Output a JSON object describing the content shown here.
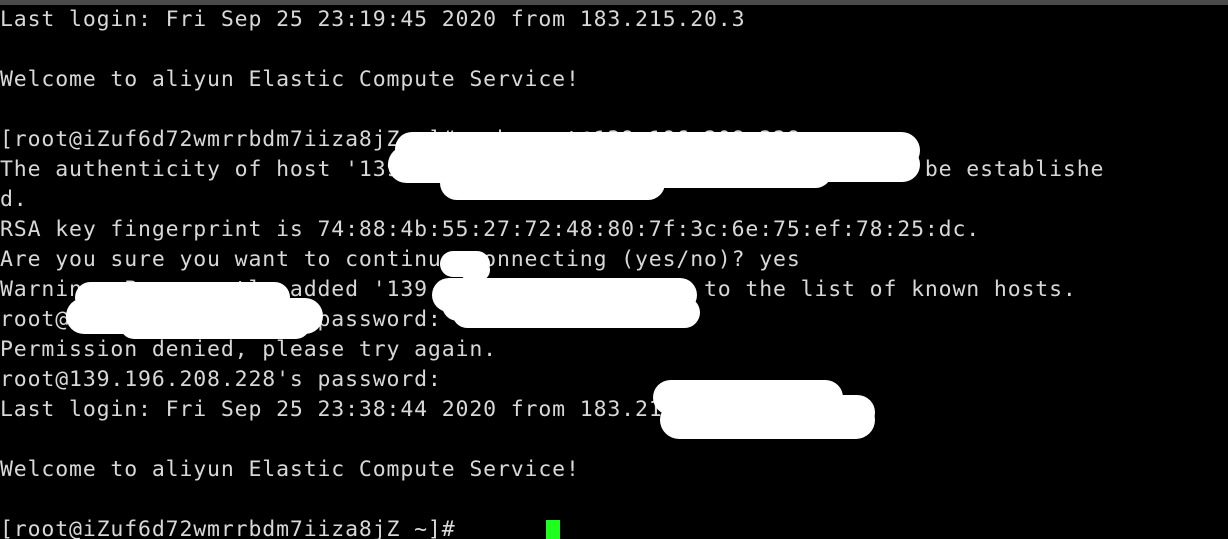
{
  "window": {
    "title_bar_color": "#4a4a4a",
    "background_color": "#000000",
    "foreground_color": "#d8d8d8",
    "cursor_color": "#1eff1e",
    "redaction_color": "#ffffff"
  },
  "terminal": {
    "lines": [
      {
        "id": "line-last-login-1",
        "text": "Last login: Fri Sep 25 23:19:45 2020 from 183.215.20.3"
      },
      {
        "id": "line-blank-1",
        "text": ""
      },
      {
        "id": "line-welcome-1",
        "text": "Welcome to aliyun Elastic Compute Service!"
      },
      {
        "id": "line-blank-2",
        "text": ""
      },
      {
        "id": "line-prompt-ssh",
        "text": "[root@iZuf6d72wmrrbdm7iiza8jZ ~]# ssh root@139.196.208.228"
      },
      {
        "id": "line-authenticity",
        "text": "The authenticity of host '139.196.208.228 (139.196.208.228)' can't be establishe"
      },
      {
        "id": "line-authenticity-wrap",
        "text": "d."
      },
      {
        "id": "line-rsa-fingerprint",
        "text": "RSA key fingerprint is 74:88:4b:55:27:72:48:80:7f:3c:6e:75:ef:78:25:dc."
      },
      {
        "id": "line-continue-prompt",
        "text": "Are you sure you want to continue connecting (yes/no)? yes"
      },
      {
        "id": "line-warning-added",
        "text": "Warning: Permanently added '139.196.208.228' (RSA) to the list of known hosts."
      },
      {
        "id": "line-password-1",
        "text": "root@139.196.208.228's password:"
      },
      {
        "id": "line-permission-denied",
        "text": "Permission denied, please try again."
      },
      {
        "id": "line-password-2",
        "text": "root@139.196.208.228's password:"
      },
      {
        "id": "line-last-login-2",
        "text": "Last login: Fri Sep 25 23:38:44 2020 from 183.215.20.3"
      },
      {
        "id": "line-blank-3",
        "text": ""
      },
      {
        "id": "line-welcome-2",
        "text": "Welcome to aliyun Elastic Compute Service!"
      },
      {
        "id": "line-blank-4",
        "text": ""
      },
      {
        "id": "line-prompt-final",
        "text": "[root@iZuf6d72wmrrbdm7iiza8jZ ~]# "
      }
    ]
  },
  "redactions": {
    "count": 9,
    "note": "white brush strokes covering host names and IP addresses"
  }
}
